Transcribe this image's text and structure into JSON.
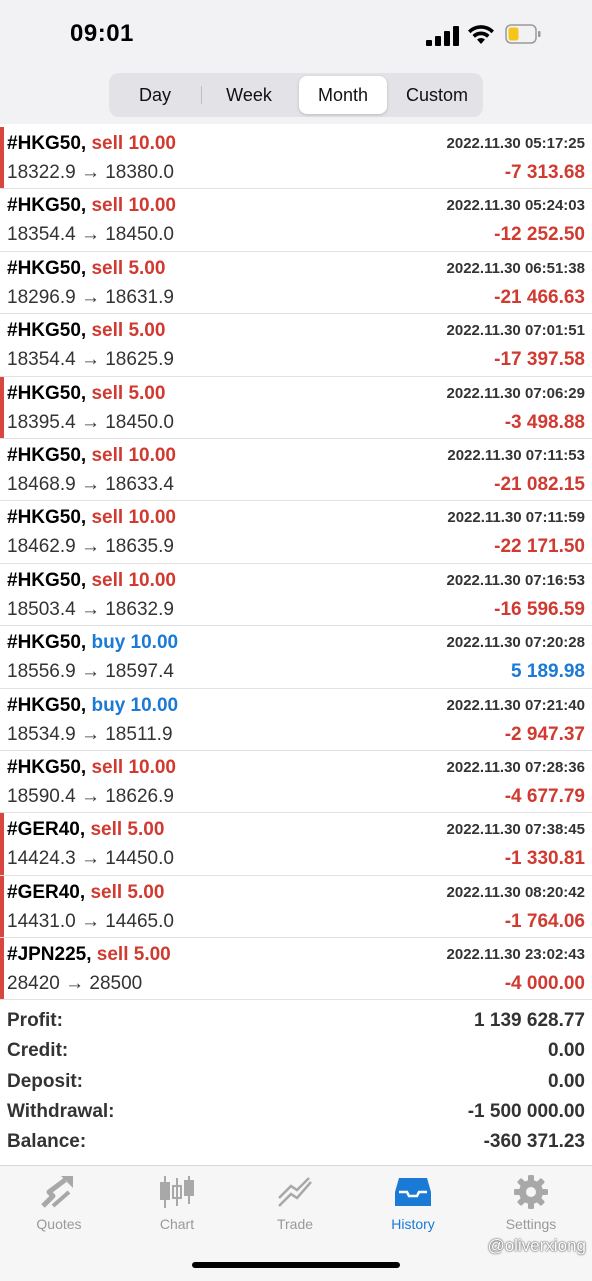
{
  "status_bar": {
    "time": "09:01"
  },
  "period_tabs": [
    {
      "label": "Day",
      "active": false
    },
    {
      "label": "Week",
      "active": false
    },
    {
      "label": "Month",
      "active": true
    },
    {
      "label": "Custom",
      "active": false
    }
  ],
  "trades": [
    {
      "symbol": "#HKG50,",
      "side": "sell 10.00",
      "type": "sell",
      "datetime": "2022.11.30 05:17:25",
      "prices": "18322.9 → 18380.0",
      "profit": "-7 313.68",
      "marker": true
    },
    {
      "symbol": "#HKG50,",
      "side": "sell 10.00",
      "type": "sell",
      "datetime": "2022.11.30 05:24:03",
      "prices": "18354.4 → 18450.0",
      "profit": "-12 252.50",
      "marker": false
    },
    {
      "symbol": "#HKG50,",
      "side": "sell 5.00",
      "type": "sell",
      "datetime": "2022.11.30 06:51:38",
      "prices": "18296.9 → 18631.9",
      "profit": "-21 466.63",
      "marker": false
    },
    {
      "symbol": "#HKG50,",
      "side": "sell 5.00",
      "type": "sell",
      "datetime": "2022.11.30 07:01:51",
      "prices": "18354.4 → 18625.9",
      "profit": "-17 397.58",
      "marker": false
    },
    {
      "symbol": "#HKG50,",
      "side": "sell 5.00",
      "type": "sell",
      "datetime": "2022.11.30 07:06:29",
      "prices": "18395.4 → 18450.0",
      "profit": "-3 498.88",
      "marker": true
    },
    {
      "symbol": "#HKG50,",
      "side": "sell 10.00",
      "type": "sell",
      "datetime": "2022.11.30 07:11:53",
      "prices": "18468.9 → 18633.4",
      "profit": "-21 082.15",
      "marker": false
    },
    {
      "symbol": "#HKG50,",
      "side": "sell 10.00",
      "type": "sell",
      "datetime": "2022.11.30 07:11:59",
      "prices": "18462.9 → 18635.9",
      "profit": "-22 171.50",
      "marker": false
    },
    {
      "symbol": "#HKG50,",
      "side": "sell 10.00",
      "type": "sell",
      "datetime": "2022.11.30 07:16:53",
      "prices": "18503.4 → 18632.9",
      "profit": "-16 596.59",
      "marker": false
    },
    {
      "symbol": "#HKG50,",
      "side": "buy 10.00",
      "type": "buy",
      "datetime": "2022.11.30 07:20:28",
      "prices": "18556.9 → 18597.4",
      "profit": "5 189.98",
      "marker": false
    },
    {
      "symbol": "#HKG50,",
      "side": "buy 10.00",
      "type": "buy",
      "datetime": "2022.11.30 07:21:40",
      "prices": "18534.9 → 18511.9",
      "profit": "-2 947.37",
      "marker": false
    },
    {
      "symbol": "#HKG50,",
      "side": "sell 10.00",
      "type": "sell",
      "datetime": "2022.11.30 07:28:36",
      "prices": "18590.4 → 18626.9",
      "profit": "-4 677.79",
      "marker": false
    },
    {
      "symbol": "#GER40,",
      "side": "sell 5.00",
      "type": "sell",
      "datetime": "2022.11.30 07:38:45",
      "prices": "14424.3 → 14450.0",
      "profit": "-1 330.81",
      "marker": true
    },
    {
      "symbol": "#GER40,",
      "side": "sell 5.00",
      "type": "sell",
      "datetime": "2022.11.30 08:20:42",
      "prices": "14431.0 → 14465.0",
      "profit": "-1 764.06",
      "marker": true
    },
    {
      "symbol": "#JPN225,",
      "side": "sell 5.00",
      "type": "sell",
      "datetime": "2022.11.30 23:02:43",
      "prices": "28420 → 28500",
      "profit": "-4 000.00",
      "marker": true
    }
  ],
  "summary": [
    {
      "label": "Profit:",
      "value": "1 139 628.77"
    },
    {
      "label": "Credit:",
      "value": "0.00"
    },
    {
      "label": "Deposit:",
      "value": "0.00"
    },
    {
      "label": "Withdrawal:",
      "value": "-1 500 000.00"
    },
    {
      "label": "Balance:",
      "value": "-360 371.23"
    }
  ],
  "tab_bar": [
    {
      "label": "Quotes",
      "icon": "quotes-icon",
      "active": false
    },
    {
      "label": "Chart",
      "icon": "chart-icon",
      "active": false
    },
    {
      "label": "Trade",
      "icon": "trade-icon",
      "active": false
    },
    {
      "label": "History",
      "icon": "history-icon",
      "active": true
    },
    {
      "label": "Settings",
      "icon": "settings-icon",
      "active": false
    }
  ],
  "watermark": "@oliverxiong",
  "colors": {
    "sell": "#d03a30",
    "buy": "#1a7ad6",
    "loss": "#d03a30",
    "gain": "#1a7ad6",
    "accent": "#1a7ad6"
  }
}
